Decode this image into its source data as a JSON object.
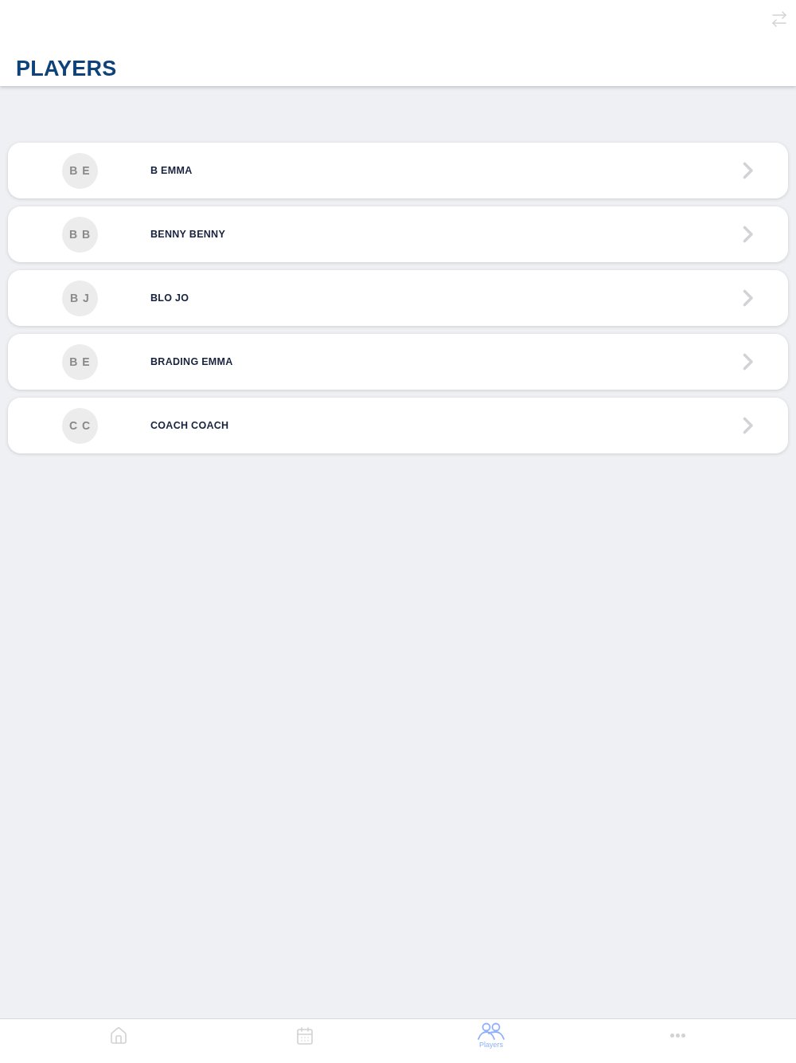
{
  "header": {
    "title": "PLAYERS"
  },
  "players": [
    {
      "initials": "B E",
      "name": "B EMMA"
    },
    {
      "initials": "B B",
      "name": "BENNY BENNY"
    },
    {
      "initials": "B J",
      "name": "BLO JO"
    },
    {
      "initials": "B E",
      "name": "BRADING EMMA"
    },
    {
      "initials": "C C",
      "name": "COACH COACH"
    }
  ],
  "tab_bar": [
    {
      "selected": false
    },
    {
      "selected": false
    },
    {
      "label": "Players",
      "selected": true
    },
    {
      "selected": false
    }
  ]
}
